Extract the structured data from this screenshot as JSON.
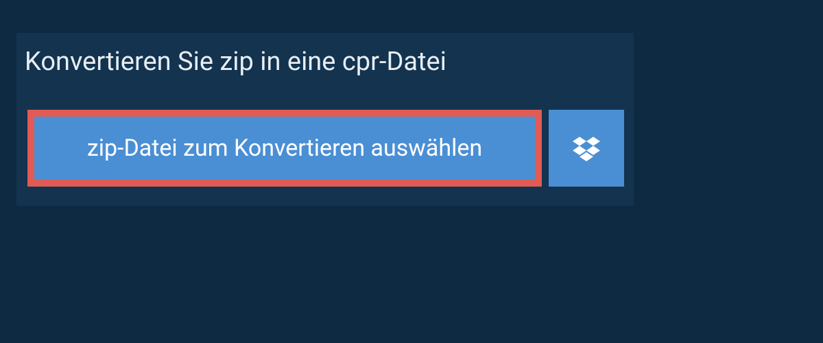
{
  "header": {
    "title": "Konvertieren Sie zip in eine cpr-Datei"
  },
  "actions": {
    "select_file_label": "zip-Datei zum Konvertieren auswählen",
    "dropbox_icon": "dropbox-icon"
  },
  "colors": {
    "page_bg": "#0e2a42",
    "panel_bg": "#13334f",
    "button_bg": "#4a8fd4",
    "highlight_border": "#e15b54",
    "text_light": "#e8eef3",
    "text_white": "#ffffff"
  }
}
